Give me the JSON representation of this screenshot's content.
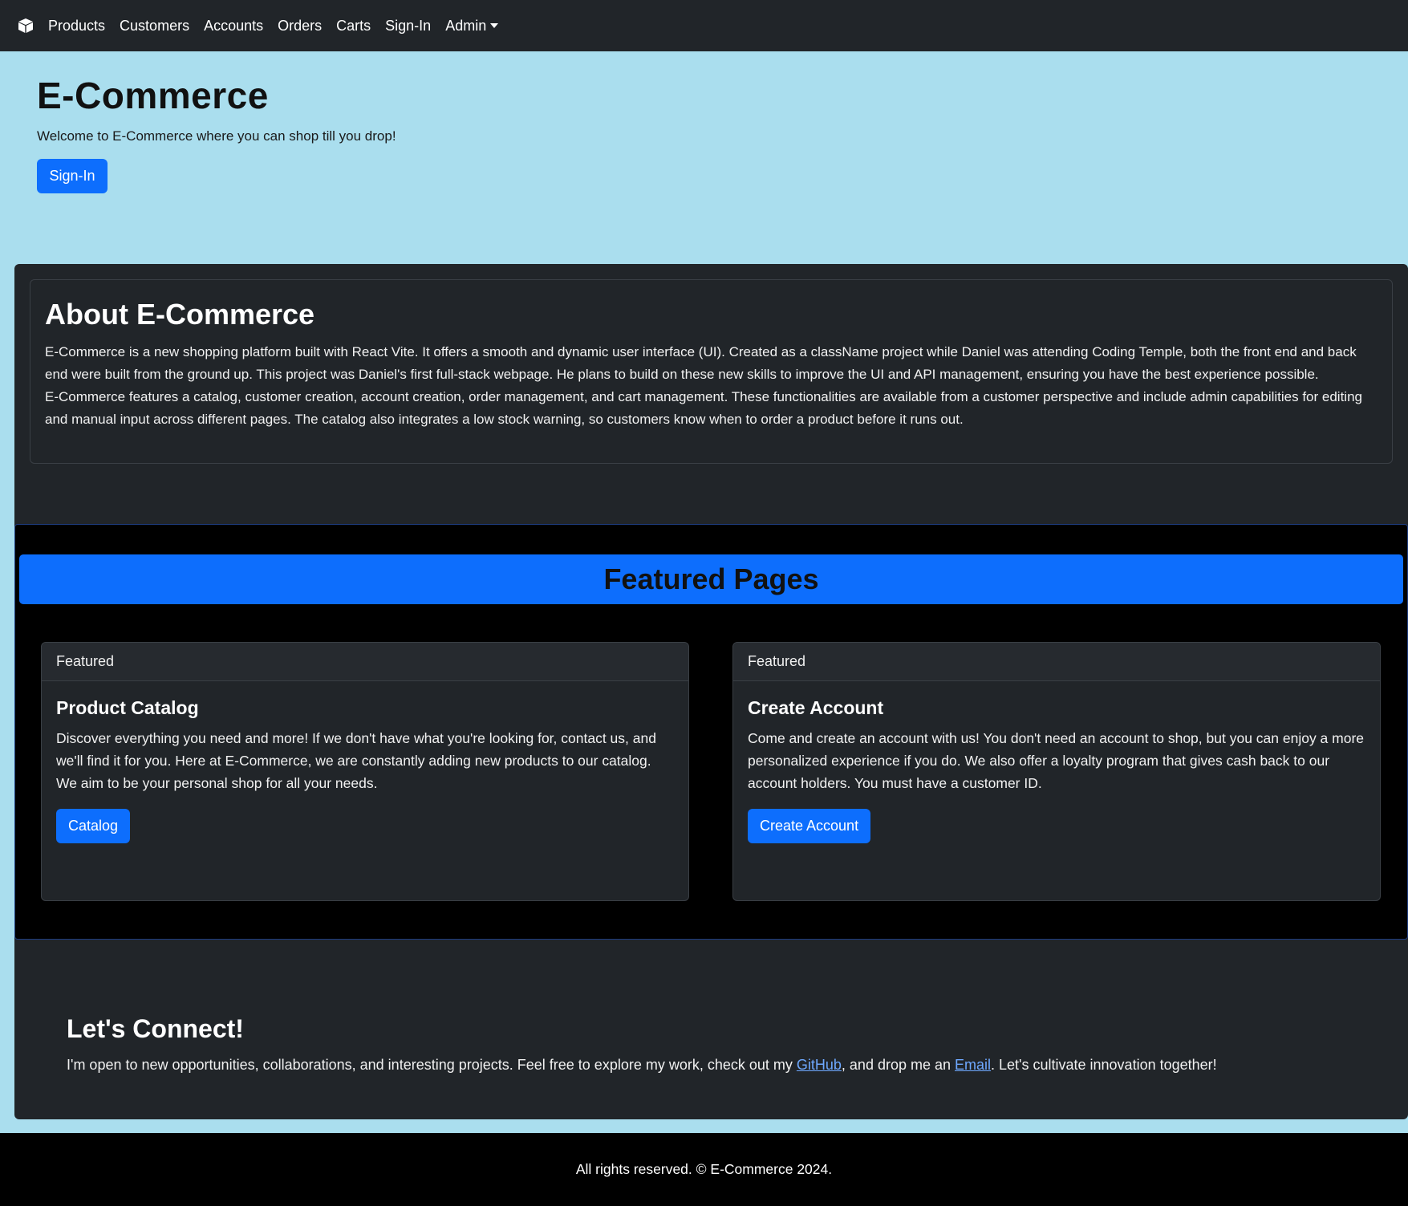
{
  "navbar": {
    "brand_icon": "box-icon",
    "links": [
      "Products",
      "Customers",
      "Accounts",
      "Orders",
      "Carts",
      "Sign-In"
    ],
    "admin_label": "Admin"
  },
  "hero": {
    "title": "E-Commerce",
    "subtitle": "Welcome to E-Commerce where you can shop till you drop!",
    "button_label": "Sign-In"
  },
  "about": {
    "title": "About E-Commerce",
    "paragraph1": "E-Commerce is a new shopping platform built with React Vite. It offers a smooth and dynamic user interface (UI). Created as a className project while Daniel was attending Coding Temple, both the front end and back end were built from the ground up. This project was Daniel's first full-stack webpage. He plans to build on these new skills to improve the UI and API management, ensuring you have the best experience possible.",
    "paragraph2": "E-Commerce features a catalog, customer creation, account creation, order management, and cart management. These functionalities are available from a customer perspective and include admin capabilities for editing and manual input across different pages. The catalog also integrates a low stock warning, so customers know when to order a product before it runs out."
  },
  "featured": {
    "banner_title": "Featured Pages",
    "cards": [
      {
        "header": "Featured",
        "title": "Product Catalog",
        "text": "Discover everything you need and more! If we don't have what you're looking for, contact us, and we'll find it for you. Here at E-Commerce, we are constantly adding new products to our catalog. We aim to be your personal shop for all your needs.",
        "button_label": "Catalog"
      },
      {
        "header": "Featured",
        "title": "Create Account",
        "text": "Come and create an account with us! You don't need an account to shop, but you can enjoy a more personalized experience if you do. We also offer a loyalty program that gives cash back to our account holders. You must have a customer ID.",
        "button_label": "Create Account"
      }
    ]
  },
  "connect": {
    "title": "Let's Connect!",
    "text_before": "I'm open to new opportunities, collaborations, and interesting projects. Feel free to explore my work, check out my ",
    "github_label": "GitHub",
    "text_middle": ", and drop me an ",
    "email_label": "Email",
    "text_after": ". Let's cultivate innovation together!"
  },
  "footer": {
    "text": "All rights reserved. © E-Commerce 2024."
  },
  "colors": {
    "navbar_bg": "#212529",
    "page_bg": "#aadeee",
    "primary": "#0d6efd",
    "link": "#6ea8fe",
    "footer_bg": "#000000"
  }
}
